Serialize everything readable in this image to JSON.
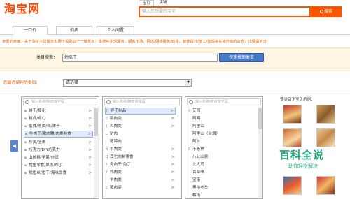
{
  "header": {
    "logo_text": "淘宝网",
    "search_tabs": [
      "宝贝",
      "店铺"
    ],
    "search_placeholder": "输入您想要的宝贝",
    "search_button": "搜索"
  },
  "tabs": [
    {
      "label": "一口价",
      "active": true
    },
    {
      "label": "拍卖",
      "active": false
    },
    {
      "label": "个人闲置",
      "active": false
    }
  ],
  "notice": "亲爱的卖家，关于淘宝主营服务市场下设的四个一级类目：本地化生活服务，服务市场，网店/网络服务/软件，装修设计/施工/监理将实施升级的公告，详情请点击",
  "category_search": {
    "label": "类目搜索：",
    "value": "地瓜干",
    "button": "快速找到类目"
  },
  "recent": {
    "label": "您最近使用的类目：",
    "select_value": "请选择"
  },
  "column1": {
    "placeholder": "输入名称/拼音首字母",
    "items": [
      {
        "label": "饼干/膨化",
        "arrow": true,
        "marker": ""
      },
      {
        "label": "糕点/点心",
        "arrow": true,
        "marker": ""
      },
      {
        "label": "蜜饯/枣类/梅/果干",
        "arrow": true,
        "marker": ""
      },
      {
        "label": "牛肉干/猪肉脯/肉类熟食",
        "arrow": true,
        "marker": "",
        "highlight": true
      },
      {
        "label": "炒货/坚果",
        "arrow": true,
        "marker": ""
      },
      {
        "label": "巧克力/DIY巧克力",
        "arrow": true,
        "marker": ""
      },
      {
        "label": "山核桃/坚果/炒货",
        "arrow": true,
        "marker": ""
      },
      {
        "label": "鳕鱼零食/果冻/布丁",
        "arrow": true,
        "marker": ""
      },
      {
        "label": "鱿鱼丝/鱼干/海味即食",
        "arrow": true,
        "marker": ""
      }
    ]
  },
  "column2": {
    "placeholder": "输入名称/拼音首字母",
    "items": [
      {
        "label": "豆干制品",
        "arrow": true,
        "marker": "D",
        "highlight": true
      },
      {
        "label": "鹅肉类",
        "arrow": true,
        "marker": "E"
      },
      {
        "label": "鸡肉类",
        "arrow": true,
        "marker": "J"
      },
      {
        "label": "驴肉",
        "arrow": false,
        "marker": "L"
      },
      {
        "label": "猪蹄肉",
        "arrow": false,
        "marker": ""
      },
      {
        "label": "牛肉类",
        "arrow": true,
        "marker": "N"
      },
      {
        "label": "其它肉制零食",
        "arrow": true,
        "marker": "Q"
      },
      {
        "label": "兔肉干/兔丁",
        "arrow": true,
        "marker": "T"
      },
      {
        "label": "鸭肉类",
        "arrow": true,
        "marker": "Y"
      },
      {
        "label": "羊肉类",
        "arrow": true,
        "marker": ""
      },
      {
        "label": "猪肉类",
        "arrow": true,
        "marker": "Z"
      }
    ]
  },
  "column3": {
    "placeholder": "输入名称/拼音首字母",
    "items": [
      {
        "label": "艾园",
        "marker": "A"
      },
      {
        "label": "阿明",
        "marker": ""
      },
      {
        "label": "阿里山",
        "marker": ""
      },
      {
        "label": "阿里山（台湾）",
        "marker": ""
      },
      {
        "label": "阿卜",
        "marker": ""
      },
      {
        "label": "不老神",
        "marker": "B"
      },
      {
        "label": "八公山泉",
        "marker": ""
      },
      {
        "label": "北大荒",
        "marker": ""
      },
      {
        "label": "百草味",
        "marker": ""
      },
      {
        "label": "宝港",
        "marker": ""
      },
      {
        "label": "黑拾老头",
        "marker": ""
      },
      {
        "label": "柏扬",
        "marker": ""
      }
    ]
  },
  "preview": {
    "title": "该类目下宝贝示例："
  },
  "watermark": {
    "main": "百科全说",
    "sub": "助你轻松解决"
  },
  "colors": {
    "brand": "#ff4400",
    "accent_blue": "#4a78c8",
    "notice": "#e86000"
  }
}
